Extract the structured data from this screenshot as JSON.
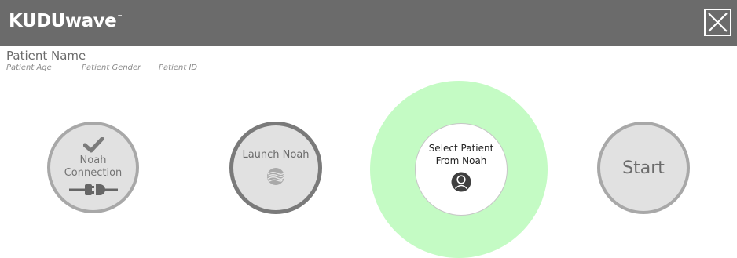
{
  "header": {
    "logo_text": "KUDUwave",
    "logo_tm": "™",
    "close_icon": "close-icon"
  },
  "patient": {
    "name": "Patient Name",
    "age": "Patient Age",
    "gender": "Patient Gender",
    "id": "Patient ID"
  },
  "steps": {
    "noah_connection": {
      "label_line1": "Noah",
      "label_line2": "Connection",
      "icons": [
        "checkmark-icon",
        "plug-icon"
      ]
    },
    "launch_noah": {
      "label": "Launch Noah",
      "icon": "noah-logo-icon"
    },
    "select_patient": {
      "label_line1": "Select Patient",
      "label_line2": "From Noah",
      "icon": "user-icon",
      "highlighted": true,
      "highlight_color": "#c4fbc4"
    },
    "start": {
      "label": "Start"
    }
  },
  "colors": {
    "topbar": "#6b6b6b",
    "step_fill": "#e1e1e1",
    "step_border": "#a8a8a8",
    "active_glow": "#c4fbc4"
  }
}
